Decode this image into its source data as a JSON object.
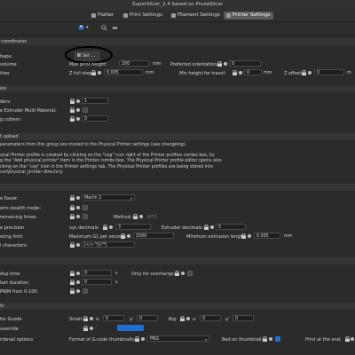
{
  "window": {
    "title": "SuperSlicer_2.4  based on PrusaSlicer"
  },
  "tabs": [
    {
      "label": "Platter"
    },
    {
      "label": "Print Settings"
    },
    {
      "label": "Filament Settings"
    },
    {
      "label": "Printer Settings"
    }
  ],
  "sections": {
    "coordinates": "coordinates",
    "limits": "ies",
    "extruders": "ies",
    "upload": "t upload",
    "firmware": "",
    "cooling": "",
    "gcode": "ts"
  },
  "fields": {
    "shape_label": "hape:",
    "shape_button": "Set ...",
    "volume_label": "volume",
    "max_print_height_label": "Max print height:",
    "max_print_height_value": "200",
    "mm1": "mm",
    "preferred_orientation_label": "Preferred orientation:",
    "preferred_orientation_value": "0",
    "z_full_step_label": "Z full step:",
    "z_full_step_value": "0.005",
    "mm2": "mm",
    "min_height_travel_label": "Min height for travel:",
    "min_height_travel_value": "0",
    "mm3": "mm",
    "z_offset_label": "Z offset:",
    "z_offset_value": "0",
    "mm4": "m",
    "ities_label": "ities",
    "extruders_label": "ders:",
    "extruders_value": "1",
    "single_extruder_label": "e Extruder Multi Material:",
    "cutters_label": "g cutters:",
    "cutters_value": "0",
    "gcode_flavor_label": "e flavor:",
    "gcode_flavor_value": "Marlin 2",
    "stealth_label": "orts stealth mode:",
    "remaining_label": "remaining times",
    "method_label": "Method:",
    "method_value": "M73",
    "precision_label": "e precision",
    "xyz_decimals_label": "xyz decimals:",
    "xyz_decimals_value": "3",
    "extruder_decimals_label": "Extruder decimals:",
    "extruder_decimals_value": "5",
    "limit_label": "ssing limit",
    "max_g1_label": "Maximum G1 per second:",
    "max_g1_value": "1500",
    "min_extrusion_label": "Minimum extrusion length:",
    "min_extrusion_value": "0.035",
    "mm5": "mm",
    "chars_label": "l characters:",
    "chars_value": "[<>:\"/\\|?*]",
    "dup_time_label": "dup time",
    "dup_time_value": "0",
    "s_unit": "s",
    "only_overhangs_label": "Only for overhangs:",
    "start_duration_label": "tart duration:",
    "start_duration_value": "0",
    "pwm_label": "PWM from 0-100:",
    "gcode_for_label": "for Gcode",
    "small_label": "Small:",
    "x_label": "x:",
    "small_x_value": "0",
    "y_label": "y:",
    "small_y_value": "0",
    "big_label": "Big:",
    "big_x_value": "0",
    "big_y_value": "0",
    "override_label": "override",
    "thumbnail_options_label": "mbnail options",
    "format_label": "Format of G-code thumbnails:",
    "format_value": "PNG",
    "bed_on_thumb_label": "Bed on thumbnail:",
    "print_at_end_label": "Print at the end:"
  },
  "upload_text": [
    "parameters from this group are moved to the Physical Printer settings (see changelog).",
    "",
    "sical Printer profile is created by clicking on the \"cog\" icon right of the Printer profiles combo box, by",
    "g the \"Add physical printer\" item in the Printer combo box. The Physical Printer profile editor opens also",
    "cking on the \"cog\" icon in the Printer settings tab. The Physical Printer profiles are being stored into",
    "cer/physical_printer directory."
  ],
  "colors": {
    "accent": "#1f6fd6",
    "active_tab": "#5a5a5a",
    "background": "#2b2b2b"
  }
}
